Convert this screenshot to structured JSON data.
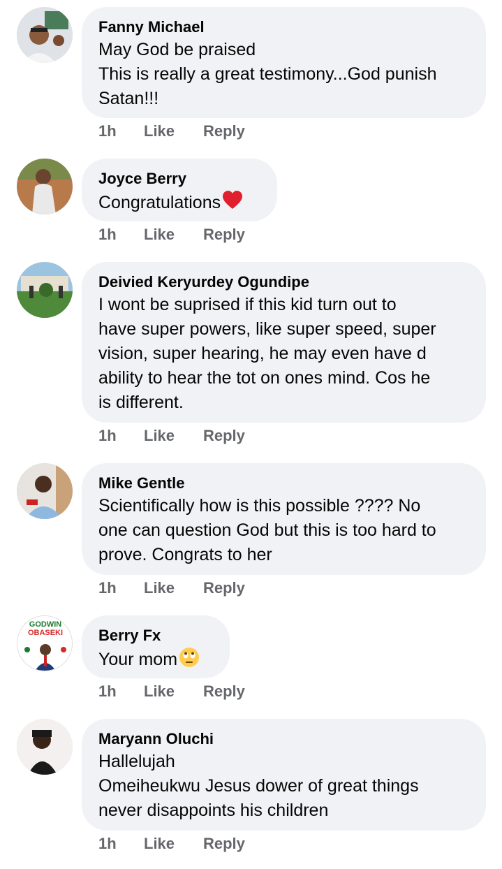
{
  "comments": [
    {
      "author": "Fanny Michael",
      "lines": [
        "May God be praised",
        "This is really a great testimony...God punish",
        "Satan!!!"
      ],
      "time": "1h",
      "like": "Like",
      "reply": "Reply"
    },
    {
      "author": "Joyce Berry",
      "lines": [
        "Congratulations"
      ],
      "emoji": "red-heart-icon",
      "time": "1h",
      "like": "Like",
      "reply": "Reply"
    },
    {
      "author": "Deivied Keryurdey Ogundipe",
      "lines": [
        "I wont be suprised if this kid turn out to",
        "have super powers, like super speed, super",
        "vision,  super hearing, he may even have d",
        "ability to hear the tot on ones mind.  Cos he",
        "is different."
      ],
      "time": "1h",
      "like": "Like",
      "reply": "Reply"
    },
    {
      "author": "Mike Gentle",
      "lines": [
        "Scientifically how is this possible ???? No",
        "one can question God but this is too hard to",
        "prove. Congrats to her"
      ],
      "time": "1h",
      "like": "Like",
      "reply": "Reply"
    },
    {
      "author": "Berry Fx",
      "lines": [
        "Your mom"
      ],
      "emoji": "eye-roll-face-icon",
      "avatar_text": [
        "GODWIN",
        "OBASEKI"
      ],
      "time": "1h",
      "like": "Like",
      "reply": "Reply"
    },
    {
      "author": "Maryann Oluchi",
      "lines": [
        "Hallelujah",
        "Omeiheukwu Jesus dower of great things",
        "never disappoints his children"
      ],
      "time": "1h",
      "like": "Like",
      "reply": "Reply"
    }
  ],
  "colors": {
    "bubble": "#f0f2f5",
    "text": "#050505",
    "meta": "#65676b",
    "heart": "#e0202e",
    "emoji_face": "#ffcc4d"
  }
}
